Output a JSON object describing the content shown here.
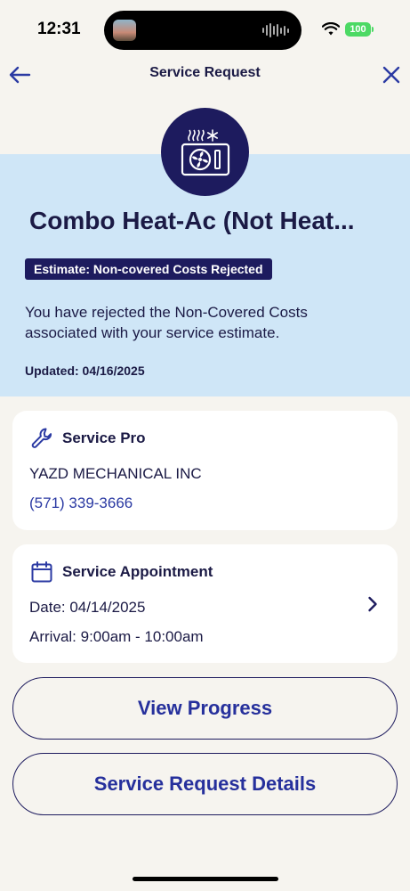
{
  "status_bar": {
    "time": "12:31",
    "battery": "100"
  },
  "nav": {
    "title": "Service Request",
    "back_icon": "arrow-left-icon",
    "close_icon": "close-icon"
  },
  "hero": {
    "icon": "hvac-unit-icon",
    "title": "Combo Heat-Ac (Not Heat...",
    "status_badge": "Estimate: Non-covered Costs Rejected",
    "message": "You have rejected the Non-Covered Costs associated with your service estimate.",
    "updated": "Updated: 04/16/2025"
  },
  "service_pro": {
    "heading": "Service Pro",
    "icon": "wrench-icon",
    "company": "YAZD MECHANICAL INC",
    "phone": "(571) 339-3666"
  },
  "appointment": {
    "heading": "Service Appointment",
    "icon": "calendar-icon",
    "date": "Date: 04/14/2025",
    "arrival": "Arrival: 9:00am - 10:00am"
  },
  "buttons": {
    "view_progress": "View Progress",
    "details": "Service Request Details"
  },
  "colors": {
    "accent": "#1d1b5e",
    "link": "#2b3aa3",
    "hero_bg": "#cfe6f7",
    "page_bg": "#f6f4ef"
  }
}
